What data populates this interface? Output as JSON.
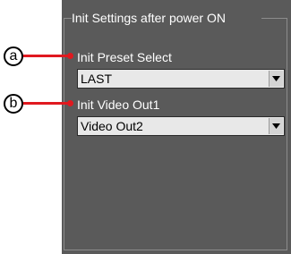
{
  "group": {
    "title": "Init Settings after power ON"
  },
  "fields": [
    {
      "callout": "a",
      "label": "Init Preset Select",
      "value": "LAST"
    },
    {
      "callout": "b",
      "label": "Init Video Out1",
      "value": "Video Out2"
    }
  ],
  "colors": {
    "panel": "#5a5a5a",
    "callout_line": "#e0191f",
    "select_bg": "#e8e8e8"
  },
  "icons": {
    "dropdown": "chevron-down-icon"
  }
}
